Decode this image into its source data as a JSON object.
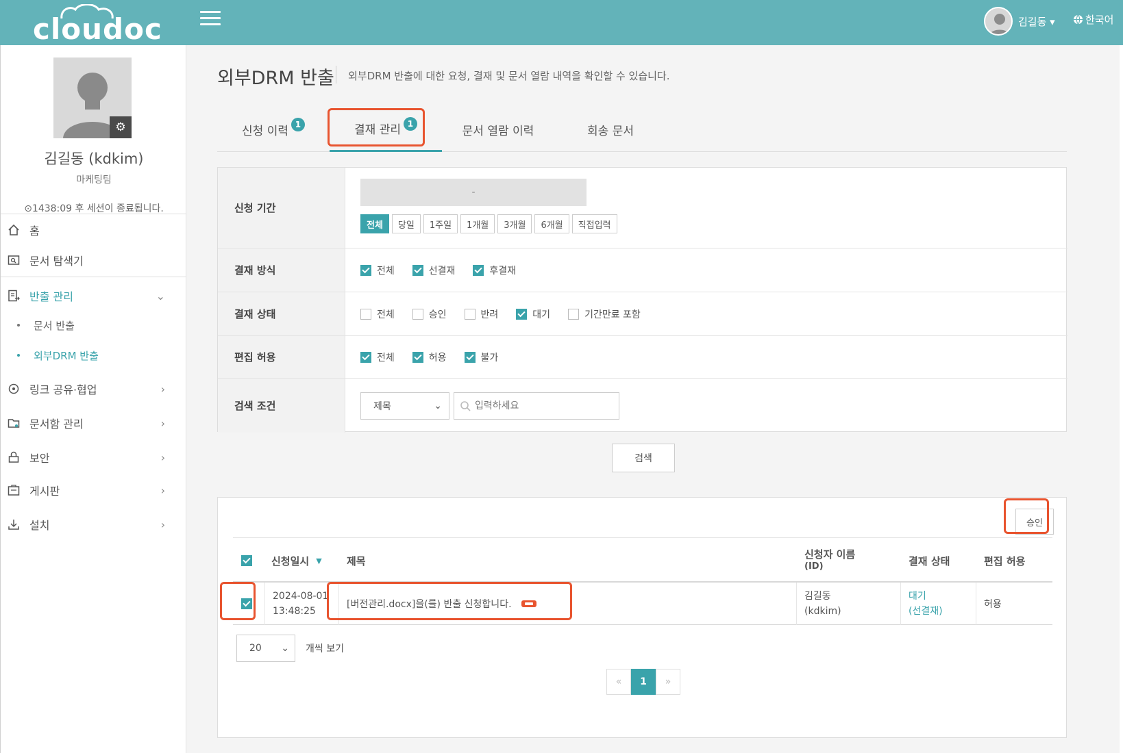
{
  "app": {
    "logo_text": "cloudoc",
    "user_label": "김길동 ▾",
    "language": "한국어"
  },
  "profile": {
    "name": "김길동 (kdkim)",
    "team": "마케팅팀",
    "session": "⊙1438:09 후 세션이 종료됩니다."
  },
  "menu": {
    "home": "홈",
    "explorer": "문서 탐색기",
    "export_mgmt": "반출 관리",
    "sub_doc_export": "문서 반출",
    "sub_drm_export": "외부DRM 반출",
    "link_share": "링크 공유·협업",
    "docbox": "문서함 관리",
    "security": "보안",
    "board": "게시판",
    "install": "설치"
  },
  "page": {
    "title": "외부DRM 반출",
    "description": "외부DRM 반출에 대한 요청, 결재 및 문서 열람 내역을 확인할 수 있습니다."
  },
  "tabs": [
    {
      "label": "신청 이력",
      "badge": "1"
    },
    {
      "label": "결재 관리",
      "badge": "1"
    },
    {
      "label": "문서 열람 이력",
      "badge": ""
    },
    {
      "label": "회송 문서",
      "badge": ""
    }
  ],
  "filter": {
    "period_label": "신청 기간",
    "date_range": "-",
    "period_buttons": [
      "전체",
      "당일",
      "1주일",
      "1개월",
      "3개월",
      "6개월",
      "직접입력"
    ],
    "method_label": "결재 방식",
    "method_options": [
      "전체",
      "선결재",
      "후결재"
    ],
    "status_label": "결재 상태",
    "status_options": [
      "전체",
      "승인",
      "반려",
      "대기",
      "기간만료 포함"
    ],
    "edit_label": "편집 허용",
    "edit_options": [
      "전체",
      "허용",
      "불가"
    ],
    "search_label": "검색 조건",
    "search_field": "제목",
    "search_placeholder": "입력하세요",
    "search_button": "검색"
  },
  "results": {
    "approve_button": "승인",
    "columns": {
      "date": "신청일시",
      "title": "제목",
      "requester": "신청자 이름",
      "requester_sub": "(ID)",
      "status": "결재 상태",
      "edit": "편집 허용"
    },
    "rows": [
      {
        "date": "2024-08-01",
        "time": "13:48:25",
        "title": "[버전관리.docx]을(를) 반출 신청합니다.",
        "requester": "김길동",
        "requester_id": "(kdkim)",
        "status": "대기",
        "status_sub": "(선결재)",
        "edit": "허용"
      }
    ],
    "page_size": "20",
    "page_size_label": "개씩 보기",
    "pager": {
      "prev": "«",
      "current": "1",
      "next": "»"
    }
  },
  "colors": {
    "brand": "#63b3b9",
    "accent": "#3aa3ab",
    "highlight": "#e8542f"
  }
}
